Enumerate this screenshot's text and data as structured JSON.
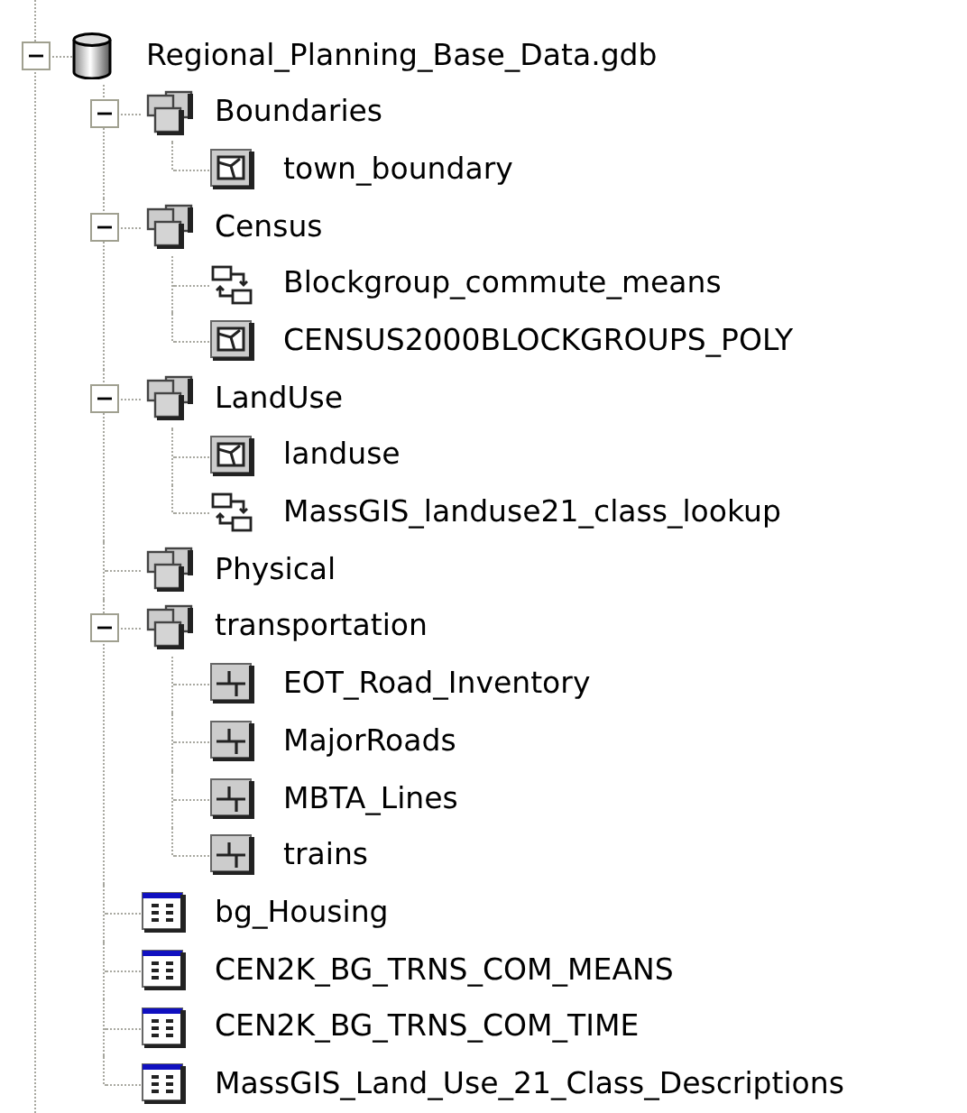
{
  "tree": [
    {
      "label": "Regional_Planning_Base_Data.gdb",
      "kind": "geodatabase",
      "expanded": true,
      "children": [
        {
          "label": "Boundaries",
          "kind": "dataset",
          "expanded": true,
          "children": [
            {
              "label": "town_boundary",
              "kind": "polygon"
            }
          ]
        },
        {
          "label": "Census",
          "kind": "dataset",
          "expanded": true,
          "children": [
            {
              "label": "Blockgroup_commute_means",
              "kind": "relationship"
            },
            {
              "label": "CENSUS2000BLOCKGROUPS_POLY",
              "kind": "polygon"
            }
          ]
        },
        {
          "label": "LandUse",
          "kind": "dataset",
          "expanded": true,
          "children": [
            {
              "label": "landuse",
              "kind": "polygon"
            },
            {
              "label": "MassGIS_landuse21_class_lookup",
              "kind": "relationship"
            }
          ]
        },
        {
          "label": "Physical",
          "kind": "dataset"
        },
        {
          "label": "transportation",
          "kind": "dataset",
          "expanded": true,
          "children": [
            {
              "label": "EOT_Road_Inventory",
              "kind": "line"
            },
            {
              "label": "MajorRoads",
              "kind": "line"
            },
            {
              "label": "MBTA_Lines",
              "kind": "line"
            },
            {
              "label": "trains",
              "kind": "line"
            }
          ]
        },
        {
          "label": "bg_Housing",
          "kind": "table"
        },
        {
          "label": "CEN2K_BG_TRNS_COM_MEANS",
          "kind": "table"
        },
        {
          "label": "CEN2K_BG_TRNS_COM_TIME",
          "kind": "table"
        },
        {
          "label": "MassGIS_Land_Use_21_Class_Descriptions",
          "kind": "table"
        }
      ]
    }
  ]
}
